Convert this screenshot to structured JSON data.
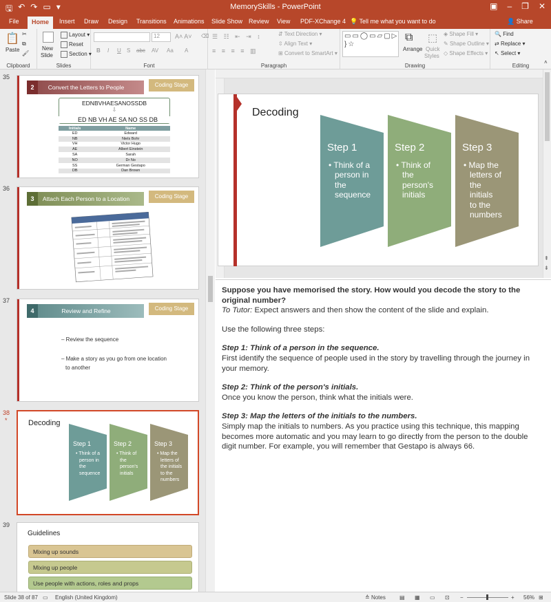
{
  "app": {
    "window_title": "MemorySkills - PowerPoint",
    "qat": [
      "save-icon",
      "undo-icon",
      "redo-icon",
      "present-icon",
      "customize-icon"
    ],
    "window_controls": {
      "min": "–",
      "restore": "❐",
      "close": "✕"
    }
  },
  "tabs": [
    {
      "label": "File"
    },
    {
      "label": "Home"
    },
    {
      "label": "Insert"
    },
    {
      "label": "Draw"
    },
    {
      "label": "Design"
    },
    {
      "label": "Transitions"
    },
    {
      "label": "Animations"
    },
    {
      "label": "Slide Show"
    },
    {
      "label": "Review"
    },
    {
      "label": "View"
    },
    {
      "label": "PDF-XChange 4"
    }
  ],
  "tell_me": "Tell me what you want to do",
  "share": "Share",
  "ribbon": {
    "clipboard": {
      "label": "Clipboard",
      "paste": "Paste"
    },
    "slides": {
      "label": "Slides",
      "new_slide": "New",
      "new_slide2": "Slide",
      "layout": "Layout",
      "reset": "Reset",
      "section": "Section"
    },
    "font": {
      "label": "Font",
      "size": "12",
      "fmt": [
        "B",
        "I",
        "U",
        "S",
        "abc",
        "AV",
        "Aa",
        "A"
      ]
    },
    "paragraph": {
      "label": "Paragraph",
      "text_direction": "Text Direction",
      "align_text": "Align Text",
      "smartart": "Convert to SmartArt"
    },
    "drawing": {
      "label": "Drawing",
      "shapes_glyphs": "▭▭◯▭▱▢▷╲╲▭▭△⌐↳⇨↑⤷╰{ }☆",
      "arrange": "Arrange",
      "quick_styles": "Quick",
      "quick_styles2": "Styles",
      "shape_fill": "Shape Fill",
      "shape_outline": "Shape Outline",
      "shape_effects": "Shape Effects"
    },
    "editing": {
      "label": "Editing",
      "find": "Find",
      "replace": "Replace",
      "select": "Select"
    }
  },
  "thumbnails": [
    {
      "number": "35",
      "step_number": "2",
      "title": "Convert the Letters to People",
      "badge": "Coding Stage",
      "code": "EDNBVHAESANOSSDB",
      "pairs": "ED  NB  VH  AE  SA  NO  SS  DB",
      "table_headers": [
        "Initials",
        "Name"
      ],
      "table_rows": [
        [
          "ED",
          "Edward"
        ],
        [
          "NB",
          "Niels Bohr"
        ],
        [
          "VH",
          "Victor Hugo"
        ],
        [
          "AE",
          "Albert Einstein"
        ],
        [
          "SA",
          "Sarah"
        ],
        [
          "NO",
          "Dr No"
        ],
        [
          "SS",
          "German Gestapo"
        ],
        [
          "DB",
          "Dan Brown"
        ]
      ]
    },
    {
      "number": "36",
      "step_number": "3",
      "title": "Attach Each Person to a Location",
      "badge": "Coding Stage"
    },
    {
      "number": "37",
      "step_number": "4",
      "title": "Review and Refine",
      "badge": "Coding Stage",
      "bullets": [
        "– Review the sequence",
        "– Make a story as you go from one location",
        "to another"
      ]
    },
    {
      "number": "38",
      "marker": "*",
      "title": "Decoding",
      "steps": [
        {
          "title": "Step 1",
          "lines": [
            "• Think of a",
            "person in",
            "the",
            "sequence"
          ]
        },
        {
          "title": "Step 2",
          "lines": [
            "• Think of",
            "the",
            "person's",
            "initials"
          ]
        },
        {
          "title": "Step 3",
          "lines": [
            "• Map the",
            "letters of",
            "the initials",
            "to the",
            "numbers"
          ]
        }
      ]
    },
    {
      "number": "39",
      "title": "Guidelines",
      "items": [
        "Mixing up sounds",
        "Mixing up people",
        "Use people with actions, roles and props"
      ]
    }
  ],
  "current_slide": {
    "title": "Decoding",
    "steps": [
      {
        "title": "Step 1",
        "lines": [
          "• Think of a",
          "person in",
          "the",
          "sequence"
        ]
      },
      {
        "title": "Step 2",
        "lines": [
          "• Think of",
          "the",
          "person's",
          "initials"
        ]
      },
      {
        "title": "Step 3",
        "lines": [
          "• Map the",
          "letters of",
          "the initials",
          "to the",
          "numbers"
        ]
      }
    ],
    "colors": {
      "step1": "#6e9c98",
      "step2": "#8fad7a",
      "step3": "#9b9677",
      "accent": "#b5312a"
    }
  },
  "notes": {
    "question": "Suppose you have memorised the story. How would you decode the story to the original number?",
    "tutor_label": "To Tutor:",
    "tutor_text": " Expect answers and then show the content of the slide and explain.",
    "intro": "Use the following three steps:",
    "step1_heading": "Step 1: Think of a person in the sequence.",
    "step1_text": "First identify the sequence of people used in the story by travelling through the journey in your memory.",
    "step2_heading": "Step 2: Think of the person's initials.",
    "step2_text": "Once you know the person, think what the initials were.",
    "step3_heading": "Step 3: Map the letters of the initials to the numbers.",
    "step3_text": "Simply map the initials to numbers. As you practice using this technique, this mapping becomes more automatic and you may learn to go directly from the person to the double digit number. For example, you will remember that Gestapo is always 66."
  },
  "status": {
    "slide_info": "Slide 38 of 87",
    "language": "English (United Kingdom)",
    "notes_label": "Notes",
    "zoom": "56%"
  }
}
